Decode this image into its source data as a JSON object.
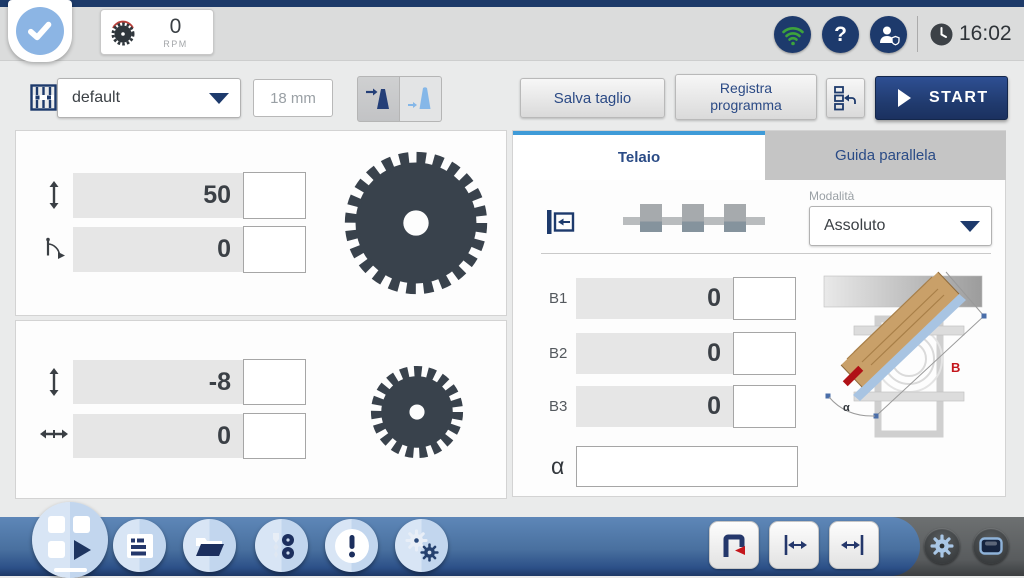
{
  "topbar": {
    "rpm_value": "0",
    "rpm_unit": "RPM",
    "time": "16:02"
  },
  "toolbar": {
    "profile": "default",
    "thickness": "18 mm",
    "save_cut": "Salva taglio",
    "record_program": "Registra programma",
    "start": "START"
  },
  "main_blade": {
    "height": "50",
    "angle": "0"
  },
  "scoring_blade": {
    "height": "-8",
    "offset": "0"
  },
  "frame_panel": {
    "tab_frame": "Telaio",
    "tab_fence": "Guida parallela",
    "mode_label": "Modalità",
    "mode_value": "Assoluto",
    "fields": [
      {
        "label": "B1",
        "value": "0"
      },
      {
        "label": "B2",
        "value": "0"
      },
      {
        "label": "B3",
        "value": "0"
      }
    ],
    "alpha_label": "α",
    "alpha_value": "",
    "diagram": {
      "b": "B",
      "alpha": "α"
    }
  },
  "icons": {
    "check": "check-icon",
    "saw_blade": "saw-blade-icon",
    "wifi": "wifi-icon",
    "help": "help-icon",
    "user": "user-shield-icon",
    "clock": "clock-icon",
    "material": "material-icon",
    "blade_main": "main-blade-toggle-icon",
    "blade_scoring": "scoring-blade-toggle-icon",
    "program_steps": "program-steps-icon",
    "play": "play-icon",
    "height_arrows": "vertical-arrows-icon",
    "angle": "angle-icon",
    "lateral_arrows": "horizontal-arrows-icon",
    "datum": "datum-reference-icon",
    "frame_stops": "frame-stops-graphic",
    "grid_play": "manual-mode-icon",
    "cut_list": "cut-list-icon",
    "folder": "folder-icon",
    "tools": "tools-icon",
    "alert": "alert-icon",
    "gears": "gears-icon",
    "hood": "blade-guard-icon",
    "fence_left": "fence-left-icon",
    "fence_right": "fence-right-icon",
    "gear": "gear-icon",
    "display": "display-icon"
  },
  "colors": {
    "accent_navy": "#1d3a6c",
    "tab_active_border": "#3f9bd8",
    "start_bg": "#203a6d",
    "wifi_green": "#3da33c",
    "alert_red": "#c4161c",
    "blade_dark": "#39424c",
    "bar_blue": "#49709f",
    "nav_circle": "#c9dcf0"
  }
}
